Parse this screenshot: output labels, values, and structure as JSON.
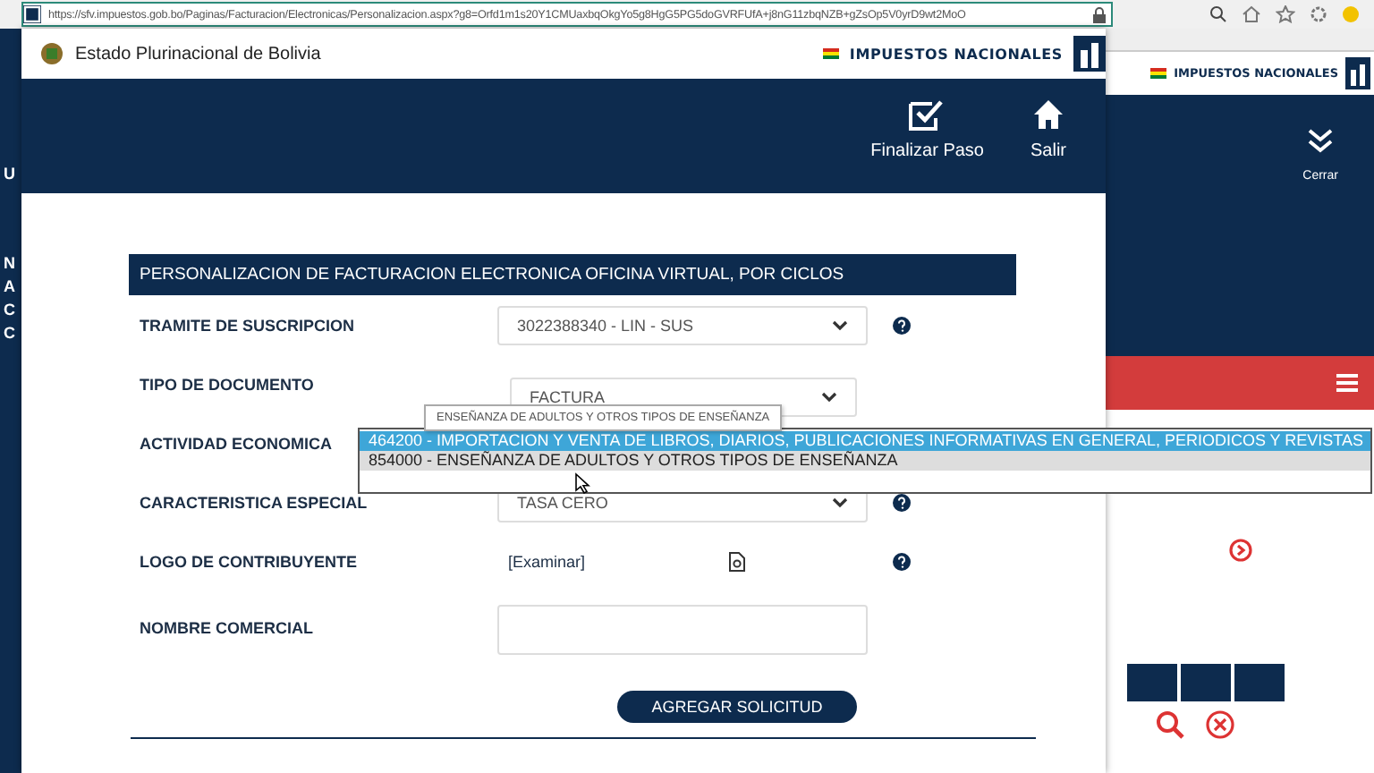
{
  "browser": {
    "url": "https://sfv.impuestos.gob.bo/Paginas/Facturacion/Electronicas/Personalizacion.aspx?g8=Orfd1m1s20Y1CMUaxbqOkgYo5g8HgG5PG5doGVRFUfA+j8nG11zbqNZB+gZsOp5V0yrD9wt2MoO"
  },
  "background": {
    "brand": "IMPUESTOS NACIONALES",
    "side_letters": [
      "U",
      "N",
      "A",
      "C",
      "C"
    ],
    "close_label": "Cerrar"
  },
  "modal": {
    "state_name": "Estado Plurinacional de Bolivia",
    "brand": "IMPUESTOS NACIONALES",
    "actions": [
      {
        "label": "Finalizar Paso",
        "kind": "finish"
      },
      {
        "label": "Salir",
        "kind": "home"
      }
    ],
    "section_title": "PERSONALIZACION DE FACTURACION ELECTRONICA OFICINA VIRTUAL, POR CICLOS",
    "fields": [
      {
        "kind": "select",
        "label": "TRAMITE DE SUSCRIPCION",
        "value": "3022388340 - LIN - SUS",
        "help": true
      },
      {
        "kind": "select",
        "label": "TIPO DE DOCUMENTO",
        "value": "FACTURA",
        "help": false
      },
      {
        "kind": "list",
        "label": "ACTIVIDAD ECONOMICA",
        "tooltip": "ENSEÑANZA DE ADULTOS Y OTROS TIPOS DE ENSEÑANZA",
        "help": false,
        "options": [
          {
            "text": "464200 - IMPORTACION Y VENTA DE LIBROS, DIARIOS, PUBLICACIONES INFORMATIVAS EN GENERAL, PERIODICOS Y REVISTAS",
            "selected": true,
            "hovered": false
          },
          {
            "text": "854000 - ENSEÑANZA DE ADULTOS Y OTROS TIPOS DE ENSEÑANZA",
            "selected": false,
            "hovered": true
          }
        ]
      },
      {
        "kind": "select",
        "label": "CARACTERISTICA ESPECIAL",
        "value": "TASA CERO",
        "help": true
      },
      {
        "kind": "file",
        "label": "LOGO DE CONTRIBUYENTE",
        "value": "[Examinar]",
        "help": true
      },
      {
        "kind": "text",
        "label": "NOMBRE COMERCIAL",
        "help": false
      }
    ],
    "submit": "AGREGAR SOLICITUD"
  }
}
